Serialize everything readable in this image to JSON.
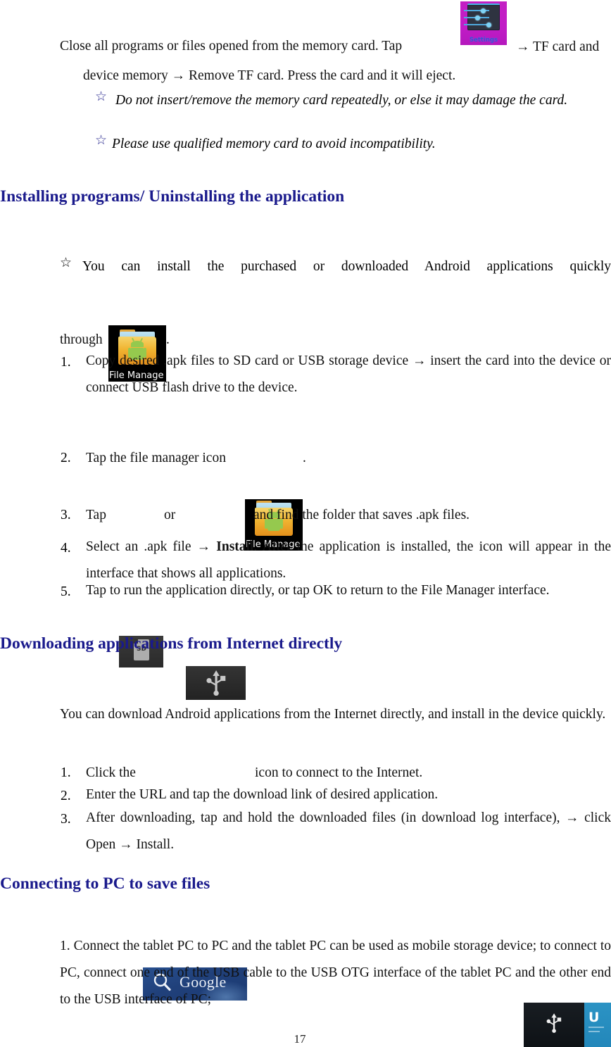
{
  "page": {
    "number": "17",
    "background_color": "#ffffff",
    "heading_color": "#1a1a8c",
    "star_blue_color": "#2a2a8f"
  },
  "sections": {
    "memory_card": {
      "line1_before_icon": "Close all programs or files opened from the memory card. Tap",
      "line1_after_icon": "→ TF card and",
      "line2": "device memory → Remove TF card. Press the card and it will eject.",
      "notes": [
        {
          "bullet": "☆",
          "bullet_style": "blue",
          "text": "Do not insert/remove the memory card repeatedly, or else it may damage the card."
        },
        {
          "bullet": "☆",
          "bullet_style": "blue",
          "text": "Please use qualified memory card to avoid incompatibility."
        }
      ]
    },
    "installing": {
      "heading": "Installing programs/ Uninstalling the application",
      "intro_bullet": "☆",
      "intro_text": "You can install the purchased or downloaded Android applications quickly",
      "intro_text2_before_icon": "through",
      "intro_text2_after_icon": ".",
      "steps": [
        {
          "num": "1.",
          "text": "Copy desired .apk files to SD card or USB storage device → insert the card into the device or connect USB flash drive to the device."
        },
        {
          "num": "2.",
          "text_before_icon": "Tap the file manager icon",
          "text_after_icon": "."
        },
        {
          "num": "3.",
          "text_before_icon1": "Tap",
          "text_between_icons": "or",
          "text_after_icon2": "and find the folder that saves .apk files."
        },
        {
          "num": "4.",
          "text_part1": "Select an .apk file → ",
          "text_bold": "Install",
          "text_part2": ". After the application is installed, the icon will appear in the interface that shows all applications."
        },
        {
          "num": "5.",
          "text": "Tap to run the application directly, or tap OK to return to the File Manager interface."
        }
      ]
    },
    "downloading": {
      "heading": "Downloading applications from Internet directly",
      "intro": "You can download Android applications from the Internet directly, and install in the device quickly.",
      "steps": [
        {
          "num": "1.",
          "text_before_icon": "Click the",
          "text_after_icon": "icon to connect to the Internet."
        },
        {
          "num": "2.",
          "text": "Enter the URL and tap the download link of desired application."
        },
        {
          "num": "3.",
          "text": "After downloading, tap and hold the downloaded files (in download log interface), → click Open → Install."
        }
      ]
    },
    "connecting": {
      "heading": "Connecting to PC to save files",
      "body": "1. Connect the tablet PC to PC and the tablet PC can be used as mobile storage device; to connect to PC, connect one end of the USB cable to the USB OTG interface of the tablet PC and the other end to the USB interface of PC;"
    }
  },
  "icons": {
    "settings": {
      "name": "settings-icon",
      "label": "Settings",
      "background_color": "#c31fc3",
      "panel_color": "#2e3340",
      "accent_color": "#4fa8dd"
    },
    "file_manager": {
      "name": "file-manager-icon",
      "label": "File Manage",
      "background_color": "#000000",
      "folder_color": "#f0b431",
      "robot_color": "#95c94e"
    },
    "sd_card": {
      "name": "sd-card-icon",
      "label": "SD",
      "background_color": "#2a2a2a",
      "card_color": "#adadad"
    },
    "usb": {
      "name": "usb-icon",
      "background_color": "#232323",
      "glyph_color": "#c9c9c9"
    },
    "google_search": {
      "name": "google-search-widget",
      "label": "Google",
      "background_color": "#20407a"
    },
    "bottom_usb_panel": {
      "name": "usb-connect-panel",
      "left_color": "#131820",
      "right_color": "#2b93c4",
      "right_label": "U"
    }
  }
}
